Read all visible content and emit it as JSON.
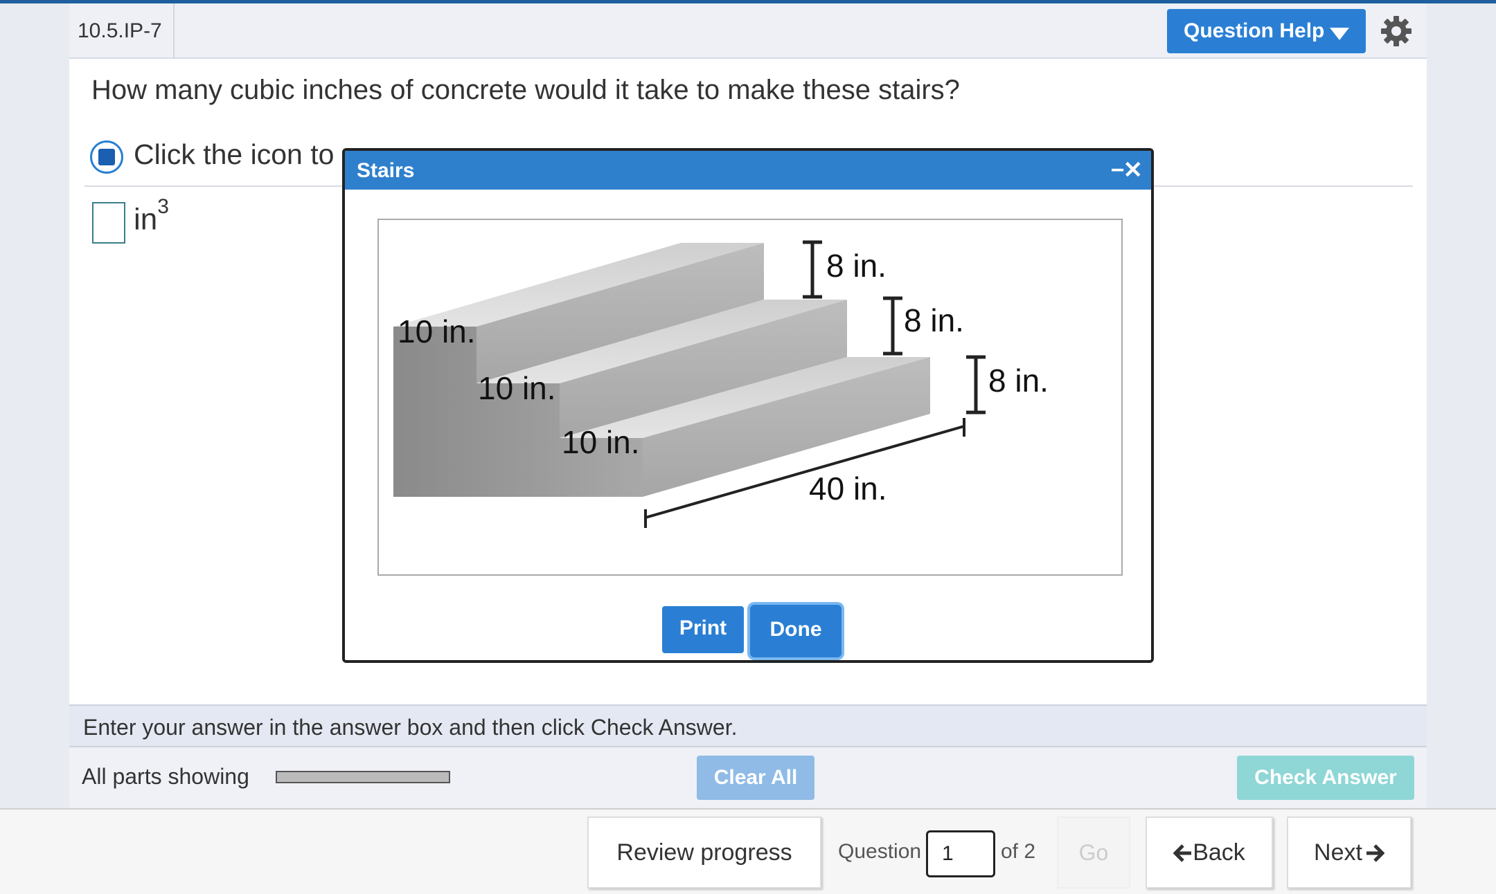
{
  "header": {
    "question_id": "10.5.IP-7",
    "help_button": "Question Help"
  },
  "question": {
    "text": "How many cubic inches of concrete would it take to make these stairs?",
    "icon_prompt": "Click the icon to",
    "unit": "in",
    "unit_exponent": "3",
    "answer_value": ""
  },
  "modal": {
    "title": "Stairs",
    "close_label": "−✕",
    "print_label": "Print",
    "done_label": "Done",
    "figure_labels": {
      "depth_top": "10 in.",
      "depth_middle": "10 in.",
      "depth_bottom": "10 in.",
      "rise_top": "8 in.",
      "rise_middle": "8 in.",
      "rise_bottom": "8 in.",
      "width": "40 in."
    }
  },
  "instruction": "Enter your answer in the answer box and then click Check Answer.",
  "parts": {
    "label": "All parts showing",
    "progress_fraction": 0
  },
  "buttons": {
    "clear_all": "Clear All",
    "check_answer": "Check Answer"
  },
  "footer": {
    "review_progress": "Review progress",
    "question_label": "Question",
    "question_number": "1",
    "of_total": "of 2",
    "go": "Go",
    "back": "Back",
    "next": "Next"
  }
}
